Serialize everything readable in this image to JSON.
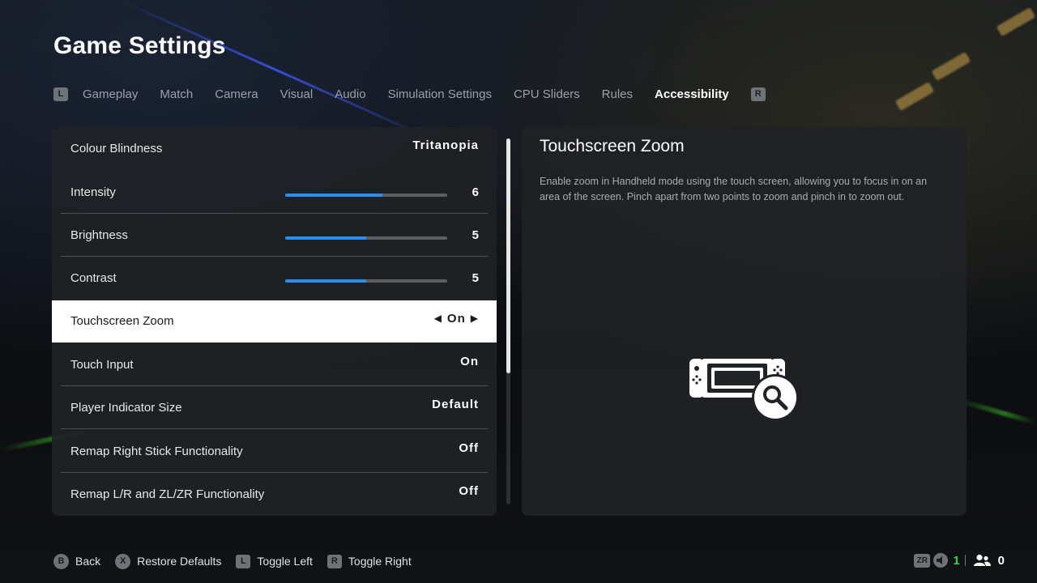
{
  "header": {
    "title": "Game Settings"
  },
  "tabs": {
    "left_button": "L",
    "right_button": "R",
    "items": [
      {
        "label": "Gameplay"
      },
      {
        "label": "Match"
      },
      {
        "label": "Camera"
      },
      {
        "label": "Visual"
      },
      {
        "label": "Audio"
      },
      {
        "label": "Simulation Settings"
      },
      {
        "label": "CPU Sliders"
      },
      {
        "label": "Rules"
      },
      {
        "label": "Accessibility",
        "active": true
      }
    ]
  },
  "settings": {
    "rows": [
      {
        "label": "Colour Blindness",
        "value": "Tritanopia"
      },
      {
        "label": "Intensity",
        "value": "6",
        "level": 0.6
      },
      {
        "label": "Brightness",
        "value": "5",
        "level": 0.5
      },
      {
        "label": "Contrast",
        "value": "5",
        "level": 0.5
      },
      {
        "label": "Touchscreen Zoom",
        "value": "On",
        "selected": true
      },
      {
        "label": "Touch Input",
        "value": "On"
      },
      {
        "label": "Player Indicator Size",
        "value": "Default"
      },
      {
        "label": "Remap Right Stick Functionality",
        "value": "Off"
      },
      {
        "label": "Remap L/R and ZL/ZR Functionality",
        "value": "Off"
      }
    ],
    "arrow_left": "◀",
    "arrow_right": "▶"
  },
  "description": {
    "title": "Touchscreen Zoom",
    "text": "Enable zoom in Handheld mode using the touch screen, allowing you to focus in on an area of the screen. Pinch apart from two points to zoom and pinch in to zoom out.",
    "illustration_icon": "handheld-zoom-icon"
  },
  "footer": {
    "items": [
      {
        "button": "B",
        "label": "Back"
      },
      {
        "button": "X",
        "label": "Restore Defaults"
      },
      {
        "button": "L",
        "label": "Toggle Left"
      },
      {
        "button": "R",
        "label": "Toggle Right"
      }
    ],
    "status": {
      "zr_button": "ZR",
      "local_players": "1",
      "online_players": "0"
    }
  },
  "colors": {
    "accent_blue": "#2b8ef3",
    "selected_row": "#ffffff",
    "player_green": "#3cd24a"
  }
}
